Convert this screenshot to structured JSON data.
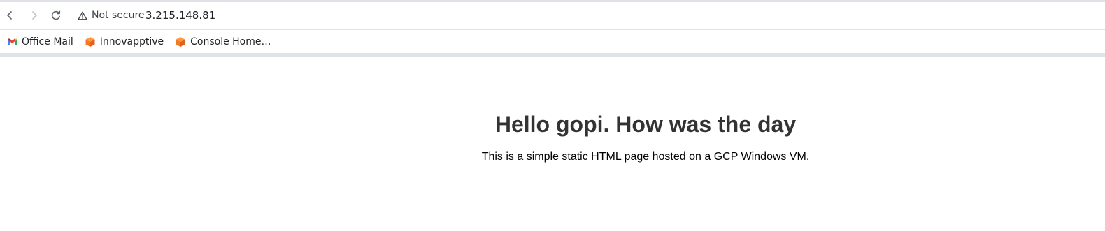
{
  "browser": {
    "security_label": "Not secure",
    "url": "3.215.148.81",
    "icons": {
      "back": "back-arrow-icon",
      "forward": "forward-arrow-icon",
      "reload": "reload-icon",
      "security": "warning-triangle-icon"
    },
    "bookmarks": [
      {
        "label": "Office Mail",
        "icon": "gmail-icon"
      },
      {
        "label": "Innovapptive",
        "icon": "orange-cube-icon"
      },
      {
        "label": "Console Home…",
        "icon": "orange-cube-icon"
      }
    ],
    "colors": {
      "chrome_border": "#dfe3e8",
      "url_text": "#202124",
      "muted_text": "#3c4043"
    }
  },
  "page": {
    "title": "Hello gopi. How was the day",
    "body": "This is a simple static HTML page hosted on a GCP Windows VM.",
    "colors": {
      "title": "#333333",
      "body": "#000000",
      "background": "#ffffff"
    }
  }
}
